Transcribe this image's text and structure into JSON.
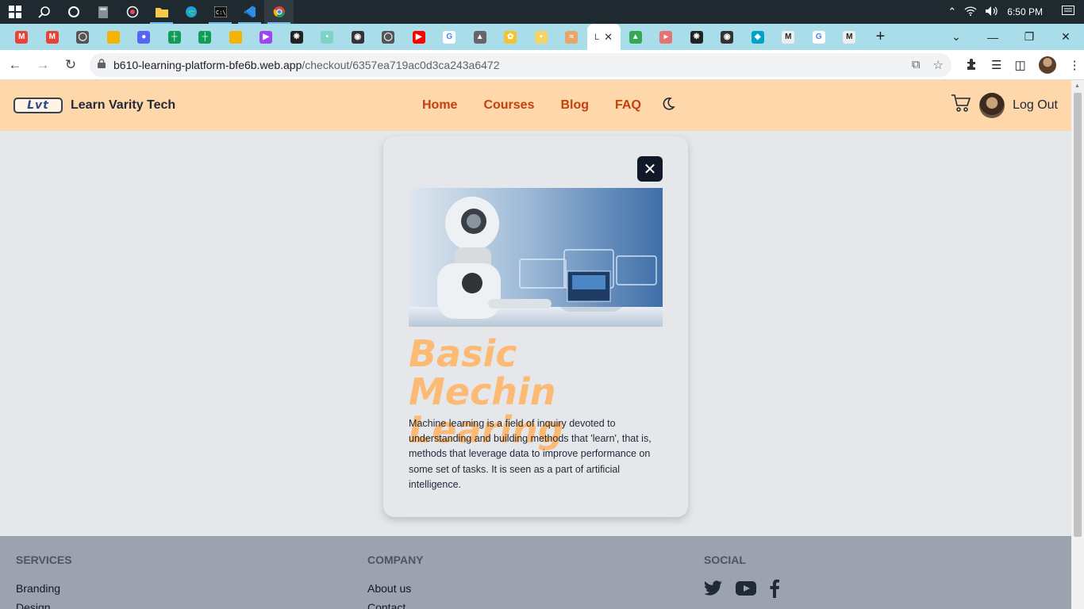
{
  "taskbar": {
    "time": "6:50 PM",
    "icons": [
      "windows-start-icon",
      "search-icon",
      "cortana-icon",
      "calculator-icon",
      "record-icon",
      "file-explorer-icon",
      "edge-icon",
      "terminal-icon",
      "vscode-icon",
      "chrome-icon"
    ]
  },
  "tabs": {
    "active_label": "L",
    "new_tab": "+",
    "favicons": [
      "gmail",
      "gmail",
      "github",
      "slides",
      "discord",
      "sheets",
      "sheets",
      "slides",
      "video",
      "react",
      "meet",
      "globe",
      "github",
      "youtube",
      "google",
      "cap",
      "sunflower",
      "bulb",
      "image",
      "active",
      "drive",
      "arrow",
      "react",
      "globe",
      "diamond",
      "m",
      "google",
      "m"
    ]
  },
  "addressbar": {
    "domain": "b610-learning-platform-bfe6b.web.app",
    "path": "/checkout/6357ea719ac0d3ca243a6472"
  },
  "navbar": {
    "logo_text": "Lvt",
    "brand": "Learn Varity Tech",
    "links": [
      "Home",
      "Courses",
      "Blog",
      "FAQ"
    ],
    "logout": "Log Out"
  },
  "course": {
    "title": "Basic Mechin Learing",
    "description": "Machine learning is a field of inquiry devoted to understanding and building methods that 'learn', that is, methods that leverage data to improve performance on some set of tasks. It is seen as a part of artificial intelligence."
  },
  "footer": {
    "services_heading": "SERVICES",
    "services_link": "Branding",
    "services_link_2": "Design",
    "company_heading": "COMPANY",
    "company_link": "About us",
    "company_link_2": "Contact",
    "social_heading": "SOCIAL",
    "social_icons": [
      "twitter-icon",
      "youtube-icon",
      "facebook-icon"
    ]
  }
}
